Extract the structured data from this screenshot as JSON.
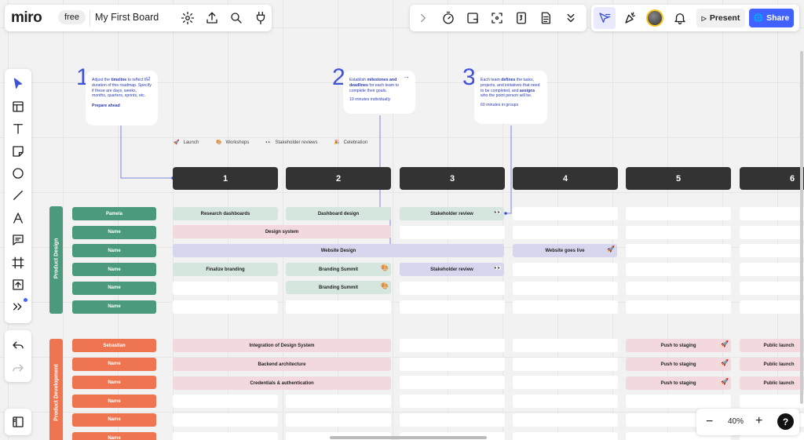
{
  "app": {
    "logo": "miro",
    "plan": "free",
    "board_title": "My First Board"
  },
  "header": {
    "present_label": "Present",
    "share_label": "Share",
    "zoom": "40%"
  },
  "steps": [
    {
      "num": "1",
      "text_html": "Adjust the <b>timeline</b> to reflect the duration of this roadmap. Specify if these are days, weeks, months, quarters, sprints, etc.",
      "footer": "Prepare ahead"
    },
    {
      "num": "2",
      "text_html": "Establish <b>milestones and deadlines</b> for each team to complete their goals.",
      "footer": "10 minutes individually"
    },
    {
      "num": "3",
      "text_html": "Each team <b>defines</b> the tasks, projects, and initiatives that need to be completed, and <b>assigns</b> who the point person will be.",
      "footer": "60 minutes in groups"
    }
  ],
  "legend": [
    {
      "icon": "🚀",
      "label": "Launch"
    },
    {
      "icon": "🎨",
      "label": "Workshops"
    },
    {
      "icon": "👀",
      "label": "Stakeholder reviews"
    },
    {
      "icon": "🎉",
      "label": "Celebration"
    }
  ],
  "columns": [
    "1",
    "2",
    "3",
    "4",
    "5",
    "6"
  ],
  "teams": [
    {
      "name": "Product Design",
      "color": "#4a9a7b"
    },
    {
      "name": "Product Development",
      "color": "#ef7550"
    }
  ],
  "design_rows": [
    "Pamela",
    "Name",
    "Name",
    "Name",
    "Name",
    "Name"
  ],
  "dev_rows": [
    "Sebastian",
    "Name",
    "Name",
    "Name",
    "Name",
    "Name"
  ],
  "tasks": {
    "research_dashboards": "Research dashboards",
    "dashboard_design": "Dashboard design",
    "stakeholder_review": "Stakeholder review",
    "design_system": "Design system",
    "website_design": "Website Design",
    "website_goes_live": "Website goes live",
    "finalize_branding": "Finalize branding",
    "branding_summit": "Branding Summit",
    "stakeholder_review_2": "Stakeholder review",
    "branding_summit_2": "Branding Summit",
    "integration": "Integration of Design System",
    "push_1": "Push to staging",
    "public_1": "Public launch",
    "backend": "Backend architecture",
    "push_2": "Push to staging",
    "public_2": "Public launch",
    "credentials": "Credentials & authentication",
    "push_3": "Push to staging",
    "public_3": "Public launch"
  }
}
